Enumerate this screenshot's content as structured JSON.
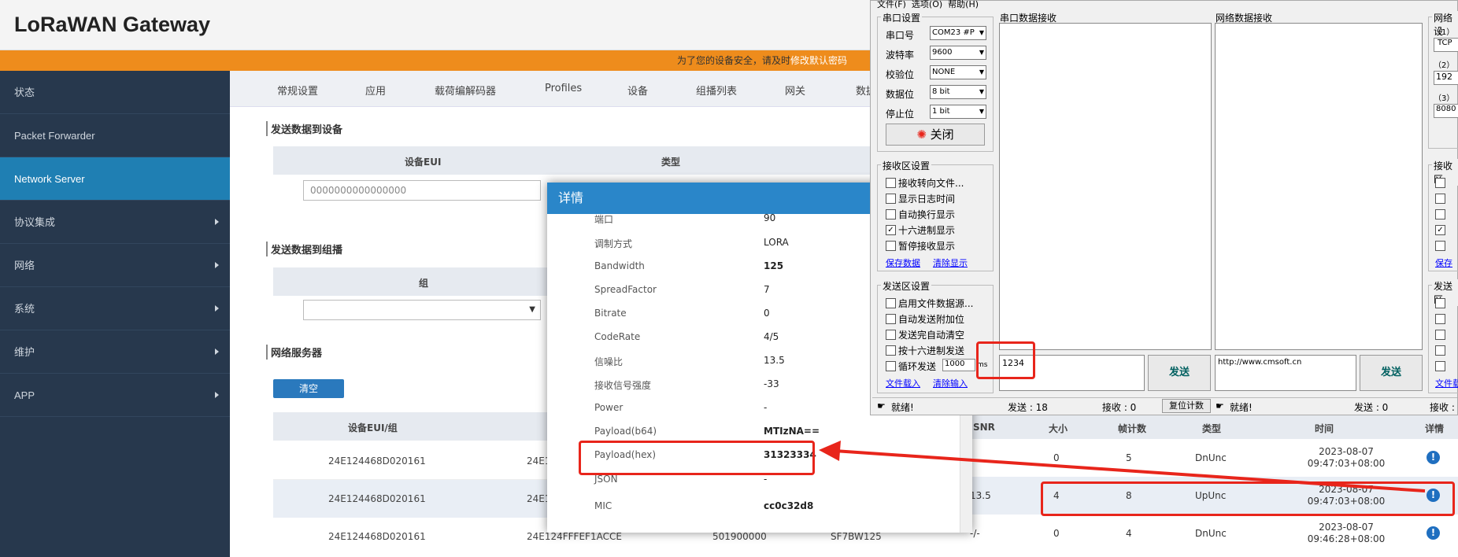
{
  "gateway": {
    "title": "LoRaWAN Gateway",
    "warning": "为了您的设备安全，请及时",
    "warning_link": "修改默认密码"
  },
  "sidebar": [
    {
      "label": "状态"
    },
    {
      "label": "Packet Forwarder"
    },
    {
      "label": "Network Server"
    },
    {
      "label": "协议集成"
    },
    {
      "label": "网络"
    },
    {
      "label": "系统"
    },
    {
      "label": "维护"
    },
    {
      "label": "APP"
    }
  ],
  "tabs": [
    "常规设置",
    "应用",
    "载荷编解码器",
    "Profiles",
    "设备",
    "组播列表",
    "网关",
    "数据"
  ],
  "send_device": {
    "title": "发送数据到设备",
    "col1": "设备EUI",
    "col2": "类型",
    "eui_placeholder": "0000000000000000"
  },
  "send_group": {
    "title": "发送数据到组播",
    "col1": "组"
  },
  "net_server": {
    "title": "网络服务器",
    "clear": "清空",
    "headers": [
      "设备EUI/组",
      "SNR",
      "大小",
      "帧计数",
      "类型",
      "时间",
      "详情"
    ],
    "rows": [
      {
        "eui": "24E124468D020161",
        "gw": "24E1",
        "snr": "",
        "size": "0",
        "fcnt": "5",
        "type": "DnUnc",
        "date": "2023-08-07",
        "time": "09:47:03+08:00"
      },
      {
        "eui": "24E124468D020161",
        "gw": "24E1",
        "snr": "13.5",
        "size": "4",
        "fcnt": "8",
        "type": "UpUnc",
        "date": "2023-08-07",
        "time": "09:47:03+08:00"
      },
      {
        "eui": "24E124468D020161",
        "gw": "24E124FFFEF1ACCE",
        "freq": "501900000",
        "sf": "SF7BW125",
        "snr": "-/-",
        "size": "0",
        "fcnt": "4",
        "type": "DnUnc",
        "date": "2023-08-07",
        "time": "09:46:28+08:00"
      }
    ]
  },
  "modal": {
    "title": "详情",
    "rows": [
      {
        "k": "端口",
        "v": "90"
      },
      {
        "k": "调制方式",
        "v": "LORA"
      },
      {
        "k": "Bandwidth",
        "v": "125"
      },
      {
        "k": "SpreadFactor",
        "v": "7"
      },
      {
        "k": "Bitrate",
        "v": "0"
      },
      {
        "k": "CodeRate",
        "v": "4/5"
      },
      {
        "k": "信噪比",
        "v": "13.5"
      },
      {
        "k": "接收信号强度",
        "v": "-33"
      },
      {
        "k": "Power",
        "v": "-"
      },
      {
        "k": "Payload(b64)",
        "v": "MTIzNA=="
      },
      {
        "k": "Payload(hex)",
        "v": "31323334"
      },
      {
        "k": "JSON",
        "v": "-"
      },
      {
        "k": "MIC",
        "v": "cc0c32d8"
      }
    ]
  },
  "serial": {
    "menu": [
      "文件(F)",
      "选项(O)",
      "帮助(H)"
    ],
    "port_group": "串口设置",
    "port_label": "串口号",
    "port_val": "COM23 #P",
    "baud_label": "波特率",
    "baud_val": "9600",
    "parity_label": "校验位",
    "parity_val": "NONE",
    "data_label": "数据位",
    "data_val": "8 bit",
    "stop_label": "停止位",
    "stop_val": "1 bit",
    "close_btn": "关闭",
    "recv_group": "接收区设置",
    "recv_opts": [
      "接收转向文件...",
      "显示日志时间",
      "自动换行显示",
      "十六进制显示",
      "暂停接收显示"
    ],
    "save_link": "保存数据",
    "clear_link": "清除显示",
    "send_group": "发送区设置",
    "send_opts": [
      "启用文件数据源...",
      "自动发送附加位",
      "发送完自动清空",
      "按十六进制发送",
      "循环发送"
    ],
    "loop_ms": "1000",
    "ms": "ms",
    "load_link": "文件载入",
    "clear_input": "清除输入",
    "serial_recv": "串口数据接收",
    "net_recv": "网络数据接收",
    "send_text": "1234",
    "send_btn": "发送",
    "net_text": "http://www.cmsoft.cn",
    "net_send_btn": "发送",
    "status_ready": "就绪!",
    "sent": "发送 : 18",
    "recv": "接收 : 0",
    "reset": "复位计数",
    "net_ready": "就绪!",
    "net_sent": "发送 : 0",
    "net_recv_count": "接收 :",
    "net_group": "网络设",
    "net_opt1": "（1）",
    "net_opt1_val": "TCP",
    "net_opt2": "（2）",
    "net_opt2_val": "192",
    "net_opt3": "（3）",
    "net_opt3_val": "8080",
    "right_recv_group": "接收区",
    "right_send_group": "发送区",
    "right_link": "保存",
    "right_link2": "文件载"
  }
}
